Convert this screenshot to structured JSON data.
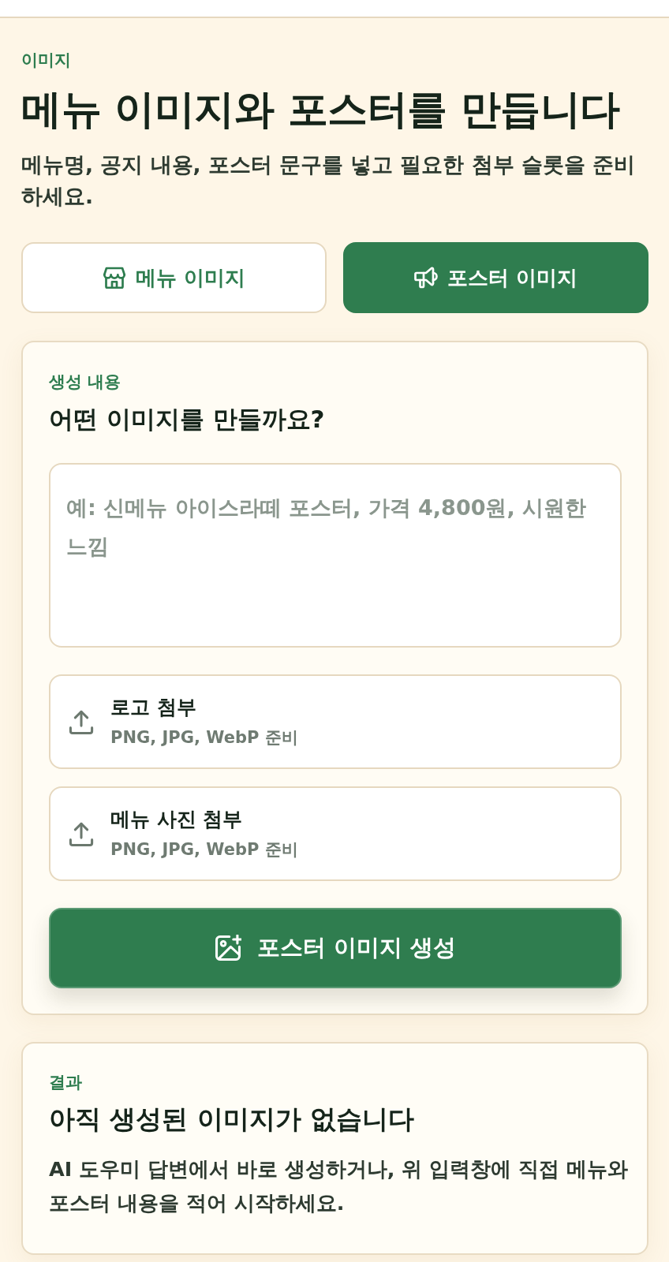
{
  "header": {
    "eyebrow": "이미지",
    "title": "메뉴 이미지와 포스터를 만듭니다",
    "subtitle": "메뉴명, 공지 내용, 포스터 문구를 넣고 필요한 첨부 슬롯을 준비하세요."
  },
  "tabs": [
    {
      "label": "메뉴 이미지",
      "selected": false
    },
    {
      "label": "포스터 이미지",
      "selected": true
    }
  ],
  "composer": {
    "eyebrow": "생성 내용",
    "heading": "어떤 이미지를 만들까요?",
    "prompt": {
      "placeholder": "예: 신메뉴 아이스라떼 포스터, 가격 4,800원, 시원한 느낌"
    },
    "attachments": [
      {
        "title": "로고 첨부",
        "hint": "PNG, JPG, WebP 준비"
      },
      {
        "title": "메뉴 사진 첨부",
        "hint": "PNG, JPG, WebP 준비"
      }
    ],
    "generate_button": "포스터 이미지 생성"
  },
  "result": {
    "eyebrow": "결과",
    "heading": "아직 생성된 이미지가 없습니다",
    "body": "AI 도우미 답변에서 바로 생성하거나, 위 입력창에 직접 메뉴와 포스터 내용을 적어 시작하세요."
  }
}
